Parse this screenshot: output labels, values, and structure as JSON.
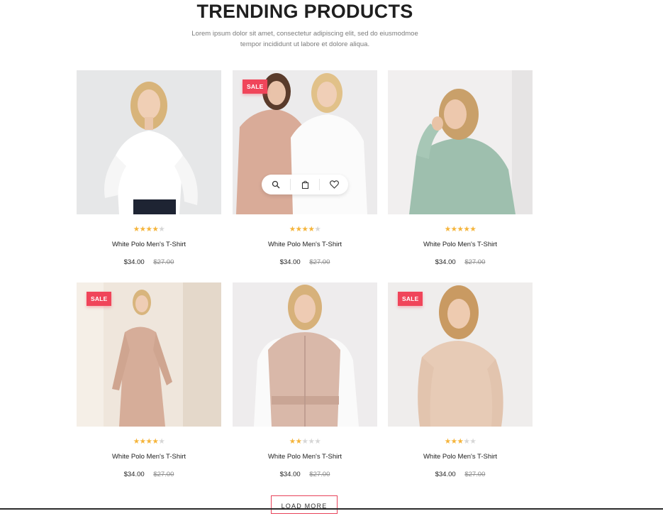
{
  "section": {
    "title": "TRENDING PRODUCTS",
    "subtitle_line1": "Lorem ipsum dolor sit amet, consectetur adipiscing elit, sed do eiusmodmoe",
    "subtitle_line2": "tempor incididunt ut labore et dolore aliqua."
  },
  "products": [
    {
      "name": "White Polo Men's T-Shirt",
      "price": "$34.00",
      "old_price": "$27.00",
      "rating": 4,
      "sale": false,
      "sale_label": "",
      "image": "woman-white-blouse"
    },
    {
      "name": "White Polo Men's T-Shirt",
      "price": "$34.00",
      "old_price": "$27.00",
      "rating": 3.5,
      "sale": true,
      "sale_label": "SALE",
      "image": "two-women-hoodies",
      "hover_actions": [
        "search-icon",
        "bag-icon",
        "heart-icon"
      ]
    },
    {
      "name": "White Polo Men's T-Shirt",
      "price": "$34.00",
      "old_price": "$27.00",
      "rating": 5,
      "sale": false,
      "sale_label": "",
      "image": "woman-green-hoodie"
    },
    {
      "name": "White Polo Men's T-Shirt",
      "price": "$34.00",
      "old_price": "$27.00",
      "rating": 4,
      "sale": true,
      "sale_label": "SALE",
      "image": "woman-beige-coat"
    },
    {
      "name": "White Polo Men's T-Shirt",
      "price": "$34.00",
      "old_price": "$27.00",
      "rating": 2,
      "sale": false,
      "sale_label": "",
      "image": "woman-puffer-vest"
    },
    {
      "name": "White Polo Men's T-Shirt",
      "price": "$34.00",
      "old_price": "$27.00",
      "rating": 3,
      "sale": true,
      "sale_label": "SALE",
      "image": "woman-beige-bodysuit"
    }
  ],
  "load_more_label": "LOAD MORE",
  "colors": {
    "accent": "#f0455a",
    "star": "#f5b43a",
    "star_empty": "#d6d6d6"
  }
}
